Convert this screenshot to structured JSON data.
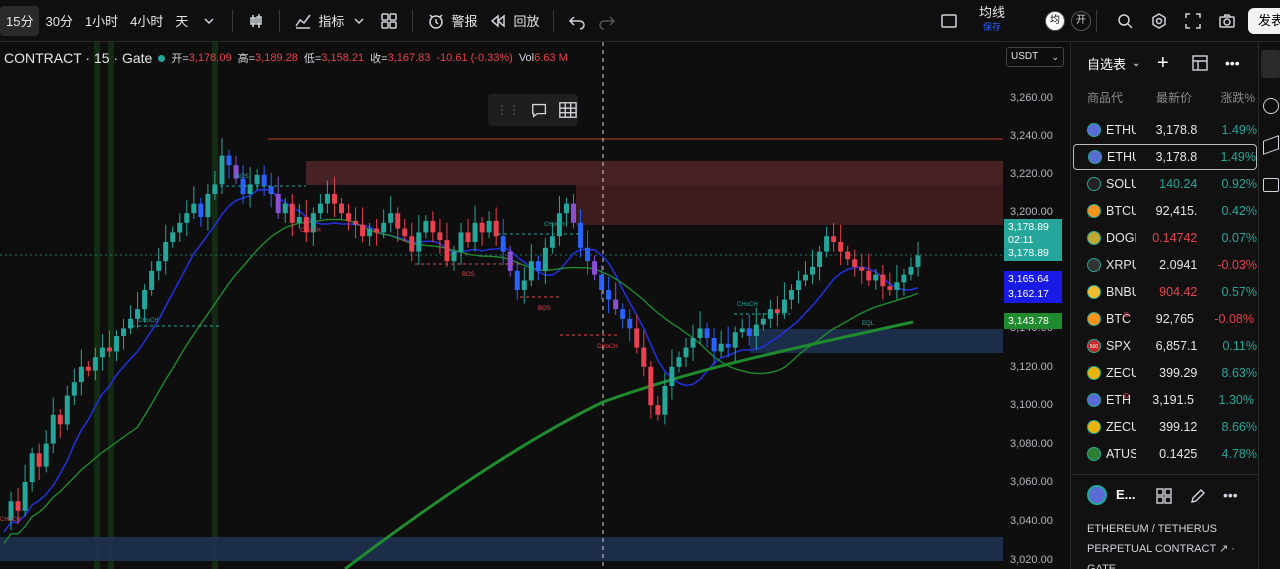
{
  "toolbar": {
    "timeframes": [
      "15分",
      "30分",
      "1小时",
      "4小时",
      "天"
    ],
    "active_timeframe": "15分",
    "indicators_label": "指标",
    "alert_label": "警报",
    "replay_label": "回放",
    "average_label": "均线",
    "save_label": "保存",
    "avg_toggle": "均",
    "open_toggle": "开",
    "publish_label": "发表"
  },
  "legend": {
    "symbol": "CONTRACT · 15 · Gate",
    "open_label": "开=",
    "open": "3,178.09",
    "high_label": "高=",
    "high": "3,189.28",
    "low_label": "低=",
    "low": "3,158.21",
    "close_label": "收=",
    "close": "3,167.83",
    "change": "-10.61 (-0.33%)",
    "vol_label": "Vol",
    "vol": "6.63 M"
  },
  "currency_select": "USDT",
  "price_axis": [
    "3,260.00",
    "3,240.00",
    "3,220.00",
    "3,200.00",
    "3,140.00",
    "3,120.00",
    "3,100.00",
    "3,080.00",
    "3,060.00",
    "3,040.00",
    "3,020.00"
  ],
  "price_labels": {
    "last_price": "3,178.89",
    "countdown": "02:11",
    "last_price_2": "3,178.89",
    "blue_top": "3,165.64",
    "blue_bottom": "3,162.17",
    "ema": "3,143.78"
  },
  "chart_annotations": [
    "BOS",
    "CHoCH",
    "CHoCH",
    "BOS",
    "BOS",
    "CHoCH",
    "CHoCH",
    "CHoCH",
    "CHoCH",
    "EQL"
  ],
  "colors": {
    "up": "#26a69a",
    "down": "#e8414f",
    "blue": "#2962ff",
    "green_line": "#1f8a2e"
  },
  "watchlist": {
    "title": "自选表",
    "columns": [
      "商品代",
      "最新价",
      "涨跌%"
    ],
    "items": [
      {
        "name": "ETHU",
        "price": "3,178.8",
        "change": "1.49%",
        "dir": "up",
        "icon": "#5b6bd6",
        "badge": ""
      },
      {
        "name": "ETHU",
        "price": "3,178.8",
        "change": "1.49%",
        "dir": "up",
        "icon": "#5b6bd6",
        "badge": ""
      },
      {
        "name": "SOLU",
        "price": "140.24",
        "change": "0.92%",
        "dir": "up",
        "icon": "#222",
        "badge": ""
      },
      {
        "name": "BTCU",
        "price": "92,415.",
        "change": "0.42%",
        "dir": "up",
        "icon": "#f7931a",
        "badge": ""
      },
      {
        "name": "DOGE",
        "price": "0.14742",
        "change": "0.07%",
        "dir": "down",
        "icon": "#c2a633",
        "badge": ""
      },
      {
        "name": "XRPU",
        "price": "2.0941",
        "change": "-0.03%",
        "dir": "down",
        "icon": "#333",
        "badge": ""
      },
      {
        "name": "BNBU",
        "price": "904.42",
        "change": "0.57%",
        "dir": "down",
        "icon": "#f3ba2f",
        "badge": ""
      },
      {
        "name": "BTC",
        "price": "92,765",
        "change": "-0.08%",
        "dir": "down",
        "icon": "#f7931a",
        "badge": "D"
      },
      {
        "name": "SPX",
        "price": "6,857.1",
        "change": "0.11%",
        "dir": "up",
        "icon": "#c62828",
        "badge": "500"
      },
      {
        "name": "ZECU",
        "price": "399.29",
        "change": "8.63%",
        "dir": "up",
        "icon": "#e8b30e",
        "badge": ""
      },
      {
        "name": "ETH",
        "price": "3,191.5",
        "change": "1.30%",
        "dir": "up",
        "icon": "#5b6bd6",
        "badge": "D"
      },
      {
        "name": "ZECU",
        "price": "399.12",
        "change": "8.66%",
        "dir": "up",
        "icon": "#e8b30e",
        "badge": ""
      },
      {
        "name": "ATUS",
        "price": "0.1425",
        "change": "4.78%",
        "dir": "up",
        "icon": "#2e7d32",
        "badge": ""
      }
    ]
  },
  "detail": {
    "title": "E...",
    "description": "ETHEREUM / TETHERUS PERPETUAL CONTRACT ↗ · GATE"
  }
}
